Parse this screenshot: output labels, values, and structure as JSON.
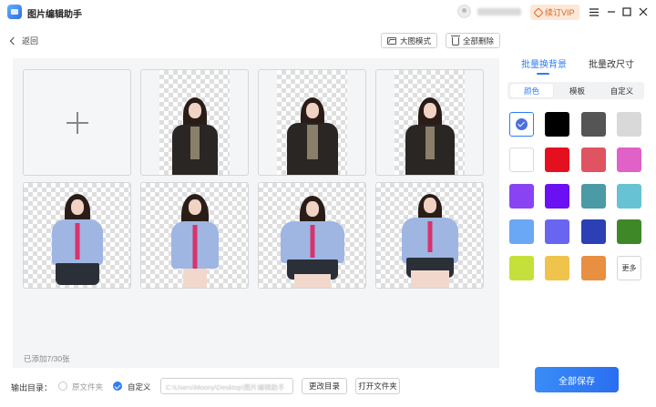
{
  "app": {
    "title": "图片编辑助手",
    "vip_label": "续订VIP"
  },
  "window_controls": [
    "menu-icon",
    "minimize-icon",
    "maximize-icon",
    "close-icon"
  ],
  "toolbar": {
    "back_label": "返回",
    "large_mode_label": "大图模式",
    "delete_all_label": "全部删除"
  },
  "gallery": {
    "count_text": "已添加7/30张",
    "image_count": 7
  },
  "output": {
    "label": "输出目录：",
    "option_original": "原文件夹",
    "option_custom": "自定义",
    "path_value": "C:\\Users\\Moony\\Desktop\\图片编辑助手",
    "change_dir_label": "更改目录",
    "open_folder_label": "打开文件夹"
  },
  "panel": {
    "tabs": [
      "批量换背景",
      "批量改尺寸"
    ],
    "active_tab": 0,
    "subtabs": [
      "颜色",
      "模板",
      "自定义"
    ],
    "active_subtab": 0,
    "more_label": "更多",
    "save_label": "全部保存",
    "colors": [
      "transparent",
      "#000000",
      "#555555",
      "#d9d9d9",
      "#ffffff",
      "#e5101f",
      "#e05360",
      "#e061c8",
      "#8a43f2",
      "#6b10f2",
      "#4b9aa6",
      "#67c3d3",
      "#6aa7f4",
      "#6866f1",
      "#2b40b5",
      "#3e8827",
      "#c6e03b",
      "#efc34c",
      "#e88f42"
    ]
  },
  "accent_color": "#2d7df6"
}
